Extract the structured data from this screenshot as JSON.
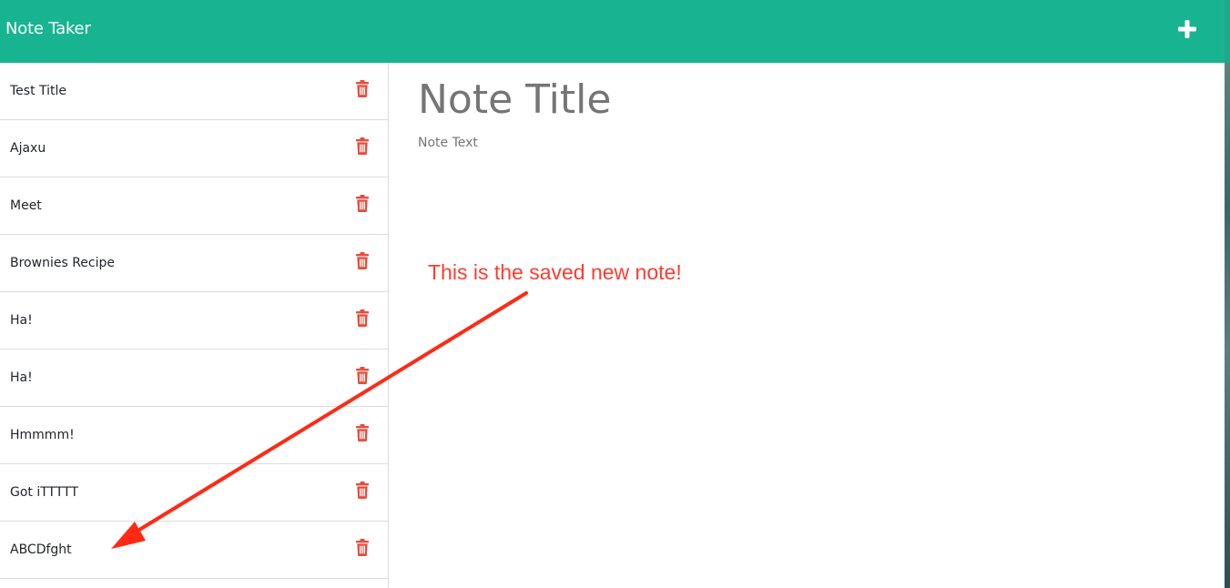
{
  "header": {
    "brand": "Note Taker",
    "new_note_icon": "plus-icon",
    "background_color": "#18b491"
  },
  "sidebar": {
    "items": [
      {
        "label": "Test Title"
      },
      {
        "label": "Ajaxu"
      },
      {
        "label": "Meet"
      },
      {
        "label": "Brownies Recipe"
      },
      {
        "label": "Ha!"
      },
      {
        "label": "Ha!"
      },
      {
        "label": "Hmmmm!"
      },
      {
        "label": "Got iTTTTT"
      },
      {
        "label": "ABCDfght"
      }
    ],
    "delete_icon": "trash-icon",
    "delete_icon_color": "#e74c3c"
  },
  "editor": {
    "title_placeholder": "Note Title",
    "text_placeholder": "Note Text"
  },
  "annotation": {
    "text": "This is the saved new note!",
    "color": "#ff3b30"
  }
}
